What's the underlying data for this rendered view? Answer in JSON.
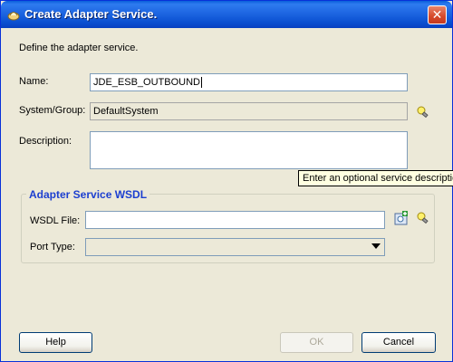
{
  "window": {
    "title": "Create Adapter Service."
  },
  "intro": "Define the adapter service.",
  "form": {
    "name_label": "Name:",
    "name_value": "JDE_ESB_OUTBOUND",
    "system_label": "System/Group:",
    "system_value": "DefaultSystem",
    "description_label": "Description:",
    "description_value": "",
    "tooltip": "Enter an optional service description"
  },
  "wsdl": {
    "group_title": "Adapter Service WSDL",
    "file_label": "WSDL File:",
    "file_value": "",
    "port_label": "Port Type:",
    "port_value": ""
  },
  "buttons": {
    "help": "Help",
    "ok": "OK",
    "cancel": "Cancel"
  },
  "icons": {
    "lamp": "lamp-icon",
    "browse": "browse-wsdl-icon",
    "title": "app-icon",
    "close": "close-icon"
  }
}
